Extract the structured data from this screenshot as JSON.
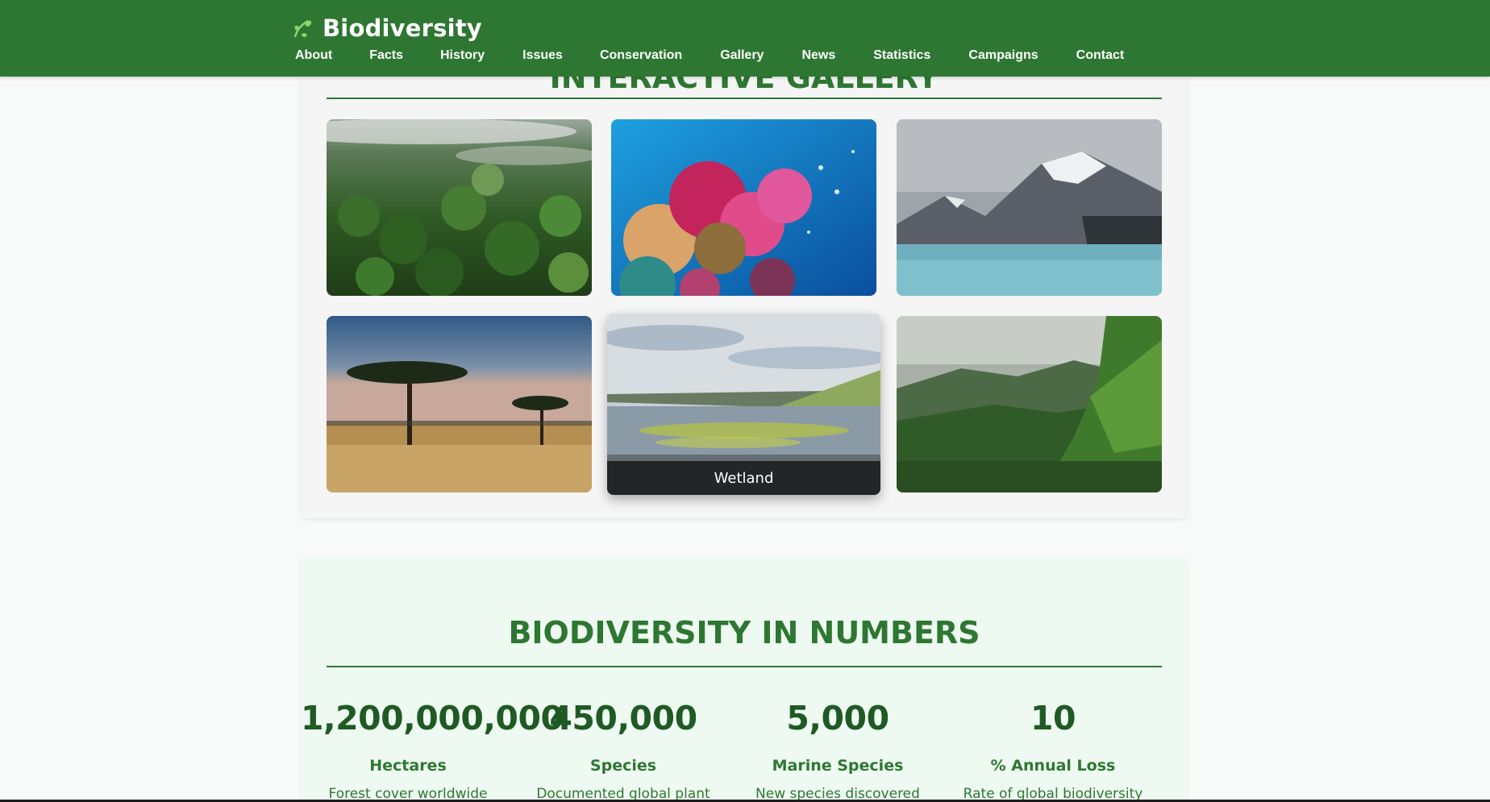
{
  "header": {
    "brand": "Biodiversity",
    "brand_icon": "leaf-icon",
    "nav": [
      "About",
      "Facts",
      "History",
      "Issues",
      "Conservation",
      "Gallery",
      "News",
      "Statistics",
      "Campaigns",
      "Contact"
    ]
  },
  "gallery": {
    "heading": "INTERACTIVE GALLERY",
    "tiles": [
      {
        "scene": "misty-rainforest"
      },
      {
        "scene": "coral-reef"
      },
      {
        "scene": "glacier-lake"
      },
      {
        "scene": "savanna-acacia"
      },
      {
        "scene": "wetland",
        "caption": "Wetland"
      },
      {
        "scene": "mountain-valley"
      }
    ]
  },
  "numbers": {
    "heading": "BIODIVERSITY IN NUMBERS",
    "stats": [
      {
        "value": "1,200,000,000",
        "label": "Hectares",
        "description": "Forest cover worldwide"
      },
      {
        "value": "450,000",
        "label": "Species",
        "description": "Documented global plant"
      },
      {
        "value": "5,000",
        "label": "Marine Species",
        "description": "New species discovered"
      },
      {
        "value": "10",
        "label": "% Annual Loss",
        "description": "Rate of global biodiversity"
      }
    ]
  },
  "colors": {
    "brand_green": "#2e7732",
    "dark_green": "#1f5a24",
    "numbers_bg": "#eefaf1"
  }
}
